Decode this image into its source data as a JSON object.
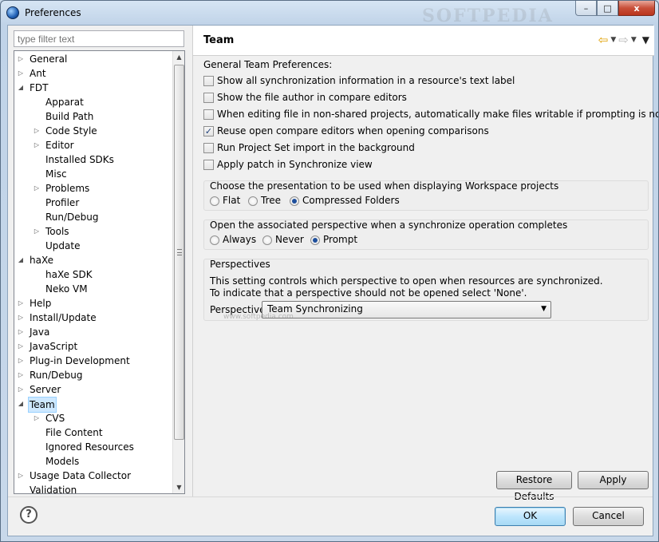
{
  "window": {
    "title": "Preferences",
    "minimize": "–",
    "maximize": "□",
    "close": "x",
    "watermark": "SOFTPEDIA"
  },
  "filter": {
    "placeholder": "type filter text"
  },
  "tree": [
    {
      "label": "General",
      "depth": 0,
      "twisty": "closed"
    },
    {
      "label": "Ant",
      "depth": 0,
      "twisty": "closed"
    },
    {
      "label": "FDT",
      "depth": 0,
      "twisty": "open"
    },
    {
      "label": "Apparat",
      "depth": 1,
      "twisty": "none"
    },
    {
      "label": "Build Path",
      "depth": 1,
      "twisty": "none"
    },
    {
      "label": "Code Style",
      "depth": 1,
      "twisty": "closed"
    },
    {
      "label": "Editor",
      "depth": 1,
      "twisty": "closed"
    },
    {
      "label": "Installed SDKs",
      "depth": 1,
      "twisty": "none"
    },
    {
      "label": "Misc",
      "depth": 1,
      "twisty": "none"
    },
    {
      "label": "Problems",
      "depth": 1,
      "twisty": "closed"
    },
    {
      "label": "Profiler",
      "depth": 1,
      "twisty": "none"
    },
    {
      "label": "Run/Debug",
      "depth": 1,
      "twisty": "none"
    },
    {
      "label": "Tools",
      "depth": 1,
      "twisty": "closed"
    },
    {
      "label": "Update",
      "depth": 1,
      "twisty": "none"
    },
    {
      "label": "haXe",
      "depth": 0,
      "twisty": "open"
    },
    {
      "label": "haXe SDK",
      "depth": 1,
      "twisty": "none"
    },
    {
      "label": "Neko VM",
      "depth": 1,
      "twisty": "none"
    },
    {
      "label": "Help",
      "depth": 0,
      "twisty": "closed"
    },
    {
      "label": "Install/Update",
      "depth": 0,
      "twisty": "closed"
    },
    {
      "label": "Java",
      "depth": 0,
      "twisty": "closed"
    },
    {
      "label": "JavaScript",
      "depth": 0,
      "twisty": "closed"
    },
    {
      "label": "Plug-in Development",
      "depth": 0,
      "twisty": "closed"
    },
    {
      "label": "Run/Debug",
      "depth": 0,
      "twisty": "closed"
    },
    {
      "label": "Server",
      "depth": 0,
      "twisty": "closed"
    },
    {
      "label": "Team",
      "depth": 0,
      "twisty": "open",
      "selected": true
    },
    {
      "label": "CVS",
      "depth": 1,
      "twisty": "closed"
    },
    {
      "label": "File Content",
      "depth": 1,
      "twisty": "none"
    },
    {
      "label": "Ignored Resources",
      "depth": 1,
      "twisty": "none"
    },
    {
      "label": "Models",
      "depth": 1,
      "twisty": "none"
    },
    {
      "label": "Usage Data Collector",
      "depth": 0,
      "twisty": "closed"
    },
    {
      "label": "Validation",
      "depth": 0,
      "twisty": "none"
    }
  ],
  "page": {
    "title": "Team",
    "section_label": "General Team Preferences:",
    "checkboxes": [
      {
        "label": "Show all synchronization information in a resource's text label",
        "checked": false
      },
      {
        "label": "Show the file author in compare editors",
        "checked": false
      },
      {
        "label": "When editing file in non-shared projects, automatically make files writable if prompting is not possible",
        "checked": false
      },
      {
        "label": "Reuse open compare editors when opening comparisons",
        "checked": true
      },
      {
        "label": "Run Project Set import in the background",
        "checked": false
      },
      {
        "label": "Apply patch in Synchronize view",
        "checked": false
      }
    ],
    "presentation": {
      "title": "Choose the presentation to be used when displaying Workspace projects",
      "options": [
        {
          "label": "Flat",
          "selected": false
        },
        {
          "label": "Tree",
          "selected": false
        },
        {
          "label": "Compressed Folders",
          "selected": true
        }
      ]
    },
    "perspective_open": {
      "title": "Open the associated perspective when a synchronize operation completes",
      "options": [
        {
          "label": "Always",
          "selected": false
        },
        {
          "label": "Never",
          "selected": false
        },
        {
          "label": "Prompt",
          "selected": true
        }
      ]
    },
    "perspectives": {
      "title": "Perspectives",
      "line1": "This setting controls which perspective to open when resources are synchronized.",
      "line2": "To indicate that a perspective should not be opened select 'None'.",
      "field_label": "Perspective:",
      "value": "Team Synchronizing"
    },
    "watermark_small": "www.softpedia.com",
    "restore_defaults": "Restore Defaults",
    "apply": "Apply"
  },
  "dialog": {
    "ok": "OK",
    "cancel": "Cancel",
    "help_glyph": "?"
  }
}
